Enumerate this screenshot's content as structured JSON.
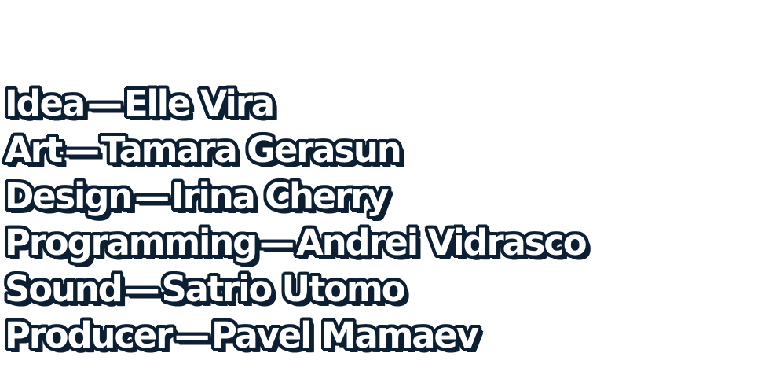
{
  "credits": {
    "lines": [
      {
        "role": "Idea",
        "separator": "—",
        "name": "Elle Vira"
      },
      {
        "role": "Art",
        "separator": "—",
        "name": "Tamara Gerasun"
      },
      {
        "role": "Design",
        "separator": "—",
        "name": "Irina Cherry"
      },
      {
        "role": "Programming",
        "separator": "—",
        "name": "Andrei Vidrasco"
      },
      {
        "role": "Sound",
        "separator": "—",
        "name": "Satrio Utomo"
      },
      {
        "role": "Producer",
        "separator": "—",
        "name": "Pavel Mamaev"
      }
    ]
  },
  "colors": {
    "background": "#ffffff",
    "text_fill": "#ffffff",
    "text_outline": "#0c1f33"
  }
}
